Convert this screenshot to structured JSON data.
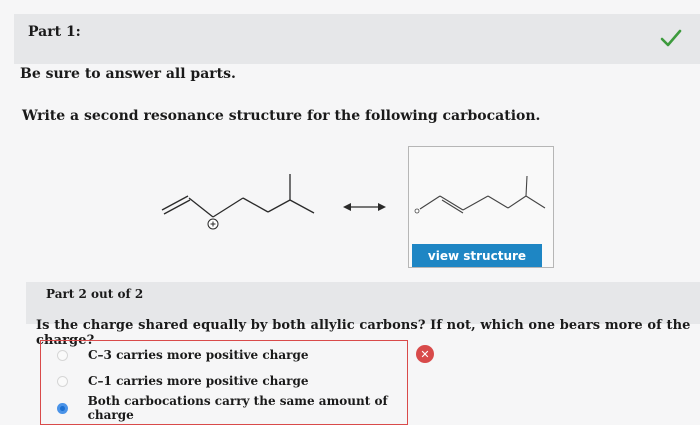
{
  "part1": {
    "label": "Part 1:"
  },
  "instructions": "Be sure to answer all parts.",
  "question": "Write a second resonance structure for the following carbocation.",
  "structure_box": {
    "button_label": "view structure"
  },
  "part2": {
    "label": "Part 2 out of 2",
    "question": "Is the charge shared equally by both allylic carbons? If not, which one bears more of the charge?",
    "options": [
      {
        "label": "C–3 carries more positive charge",
        "selected": false
      },
      {
        "label": "C–1 carries more positive charge",
        "selected": false
      },
      {
        "label": "Both carbocations carry the same amount of charge",
        "selected": true
      }
    ]
  },
  "colors": {
    "accent": "#1e86c4",
    "correct": "#3d9b3d",
    "incorrect": "#d84a4a"
  },
  "icons": {
    "correct": "check-icon",
    "incorrect": "x-icon"
  }
}
